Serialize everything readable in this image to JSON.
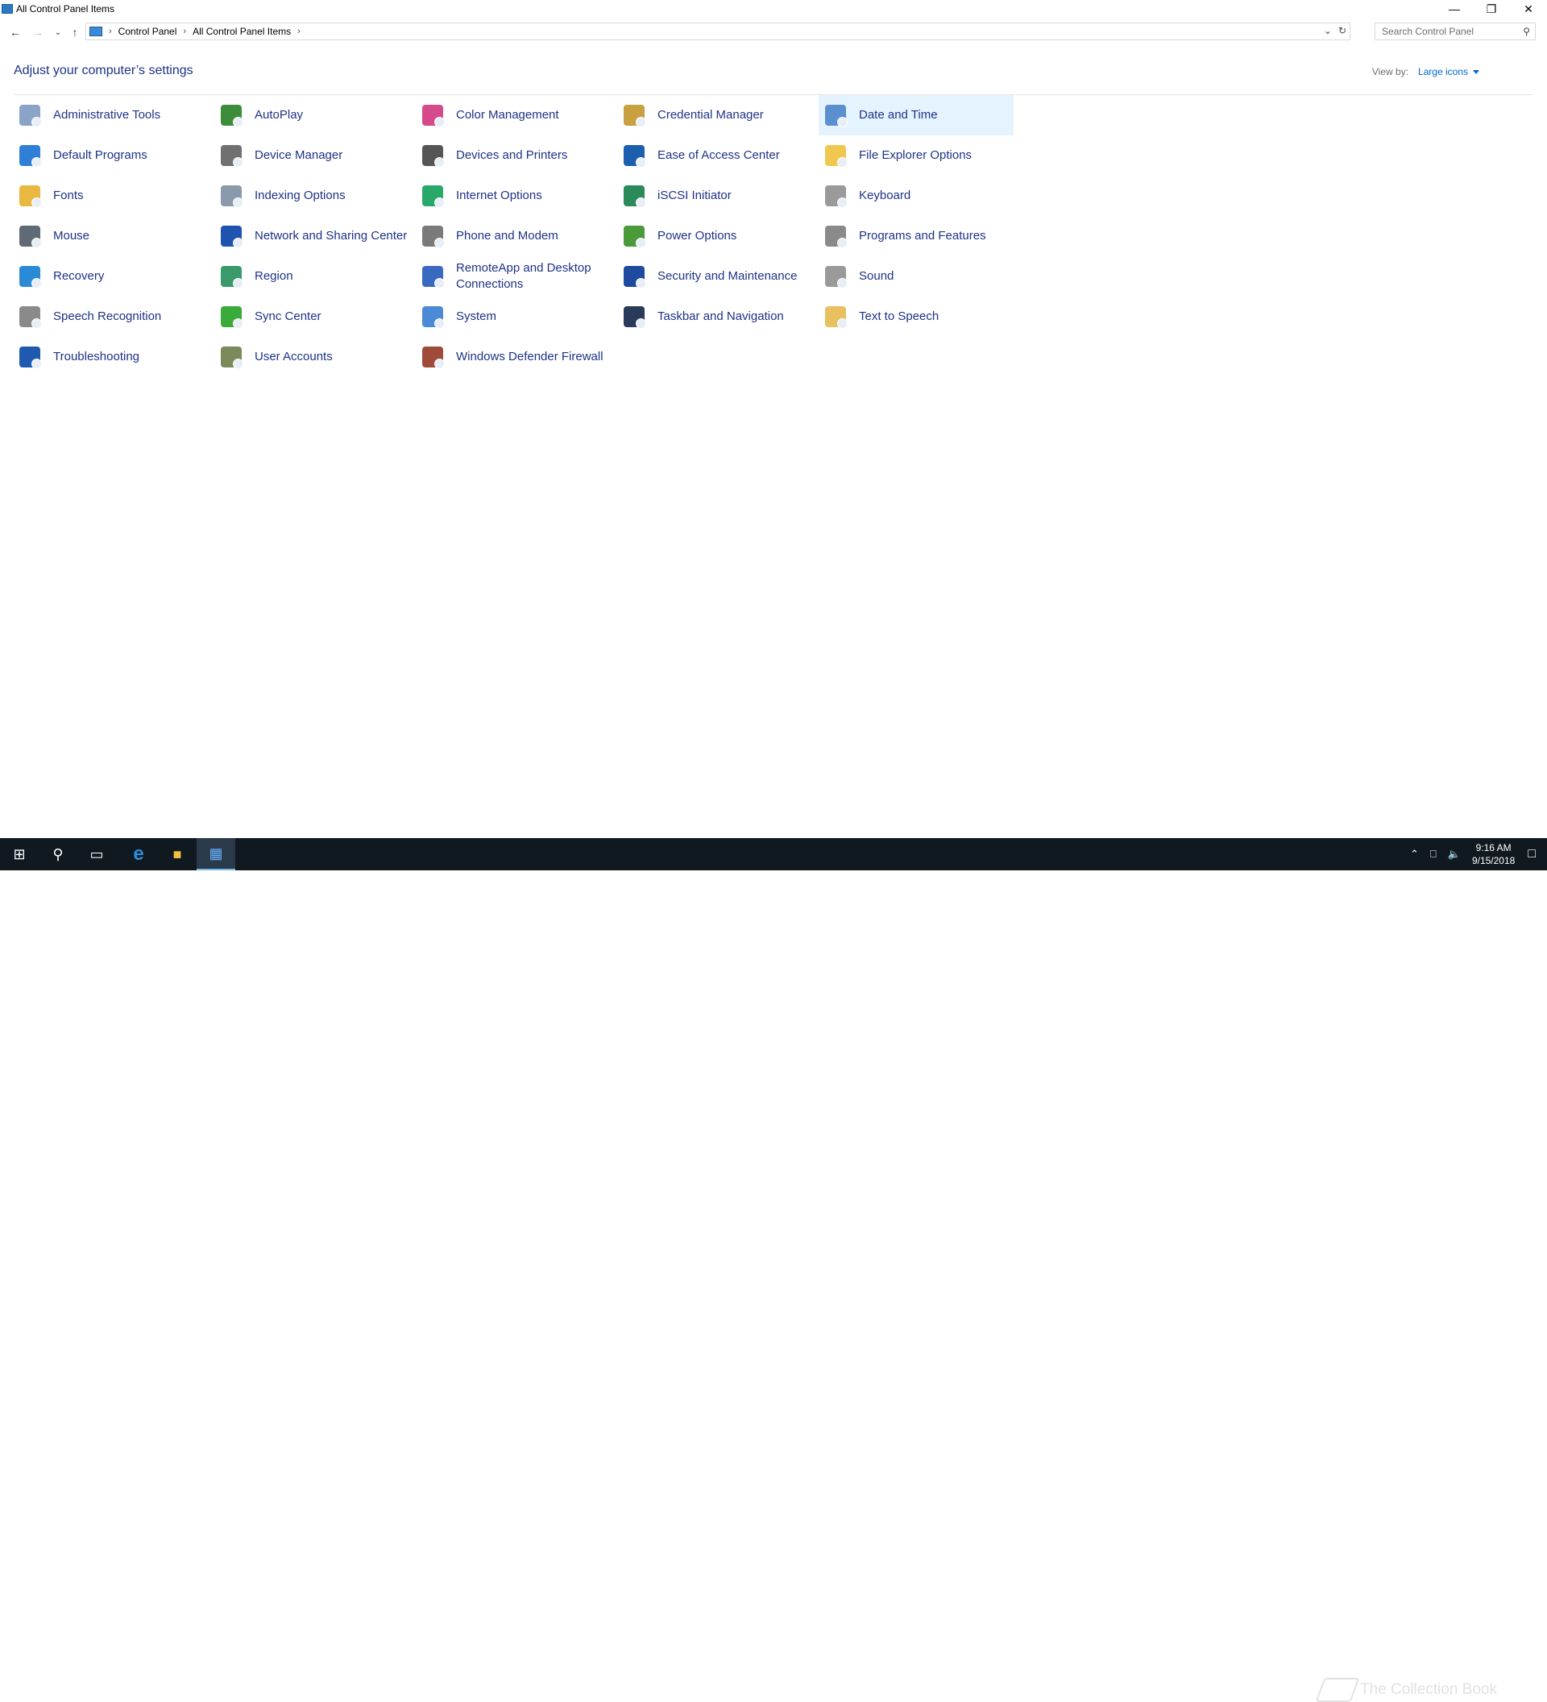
{
  "window": {
    "title": "All Control Panel Items",
    "minimize_icon": "minimize-icon",
    "maximize_icon": "restore-icon",
    "close_icon": "close-icon"
  },
  "address_bar": {
    "breadcrumbs": [
      "Control Panel",
      "All Control Panel Items"
    ],
    "search_placeholder": "Search Control Panel"
  },
  "header": {
    "title": "Adjust your computer’s settings",
    "view_by_label": "View by:",
    "view_by_value": "Large icons"
  },
  "items": [
    {
      "label": "Administrative Tools",
      "icon": "administrative-tools-icon",
      "color": "#8aa4c8"
    },
    {
      "label": "AutoPlay",
      "icon": "autoplay-icon",
      "color": "#3c8c3c"
    },
    {
      "label": "Color Management",
      "icon": "color-management-icon",
      "color": "#d44a8a"
    },
    {
      "label": "Credential Manager",
      "icon": "credential-manager-icon",
      "color": "#c8a040"
    },
    {
      "label": "Date and Time",
      "icon": "date-and-time-icon",
      "color": "#5a8fd0"
    },
    {
      "label": "Default Programs",
      "icon": "default-programs-icon",
      "color": "#2f7fd6"
    },
    {
      "label": "Device Manager",
      "icon": "device-manager-icon",
      "color": "#707070"
    },
    {
      "label": "Devices and Printers",
      "icon": "devices-and-printers-icon",
      "color": "#555555"
    },
    {
      "label": "Ease of Access Center",
      "icon": "ease-of-access-icon",
      "color": "#1c5fae"
    },
    {
      "label": "File Explorer Options",
      "icon": "file-explorer-options-icon",
      "color": "#f0c850"
    },
    {
      "label": "Fonts",
      "icon": "fonts-icon",
      "color": "#e8b840"
    },
    {
      "label": "Indexing Options",
      "icon": "indexing-options-icon",
      "color": "#8a9aaa"
    },
    {
      "label": "Internet Options",
      "icon": "internet-options-icon",
      "color": "#2aa86a"
    },
    {
      "label": "iSCSI Initiator",
      "icon": "iscsi-initiator-icon",
      "color": "#2a8a5a"
    },
    {
      "label": "Keyboard",
      "icon": "keyboard-icon",
      "color": "#9a9a9a"
    },
    {
      "label": "Mouse",
      "icon": "mouse-icon",
      "color": "#606a74"
    },
    {
      "label": "Network and Sharing Center",
      "icon": "network-sharing-icon",
      "color": "#1e54b0"
    },
    {
      "label": "Phone and Modem",
      "icon": "phone-and-modem-icon",
      "color": "#7a7a7a"
    },
    {
      "label": "Power Options",
      "icon": "power-options-icon",
      "color": "#4a9a3a"
    },
    {
      "label": "Programs and Features",
      "icon": "programs-and-features-icon",
      "color": "#8a8a8a"
    },
    {
      "label": "Recovery",
      "icon": "recovery-icon",
      "color": "#2a8ad6"
    },
    {
      "label": "Region",
      "icon": "region-icon",
      "color": "#3a9a6a"
    },
    {
      "label": "RemoteApp and Desktop Connections",
      "icon": "remoteapp-icon",
      "color": "#3a6ac0"
    },
    {
      "label": "Security and Maintenance",
      "icon": "security-maintenance-flag-icon",
      "color": "#1e4aa0"
    },
    {
      "label": "Sound",
      "icon": "sound-icon",
      "color": "#9a9a9a"
    },
    {
      "label": "Speech Recognition",
      "icon": "speech-recognition-icon",
      "color": "#8a8a8a"
    },
    {
      "label": "Sync Center",
      "icon": "sync-center-icon",
      "color": "#3aaa3a"
    },
    {
      "label": "System",
      "icon": "system-icon",
      "color": "#4a8ad6"
    },
    {
      "label": "Taskbar and Navigation",
      "icon": "taskbar-navigation-icon",
      "color": "#2a3a5a"
    },
    {
      "label": "Text to Speech",
      "icon": "text-to-speech-icon",
      "color": "#e8c060"
    },
    {
      "label": "Troubleshooting",
      "icon": "troubleshooting-icon",
      "color": "#1e5ab0"
    },
    {
      "label": "User Accounts",
      "icon": "user-accounts-icon",
      "color": "#7a8a5a"
    },
    {
      "label": "Windows Defender Firewall",
      "icon": "firewall-icon",
      "color": "#a04a3a"
    }
  ],
  "taskbar": {
    "time": "9:16 AM",
    "date": "9/15/2018",
    "watermark": "The Collection Book"
  }
}
